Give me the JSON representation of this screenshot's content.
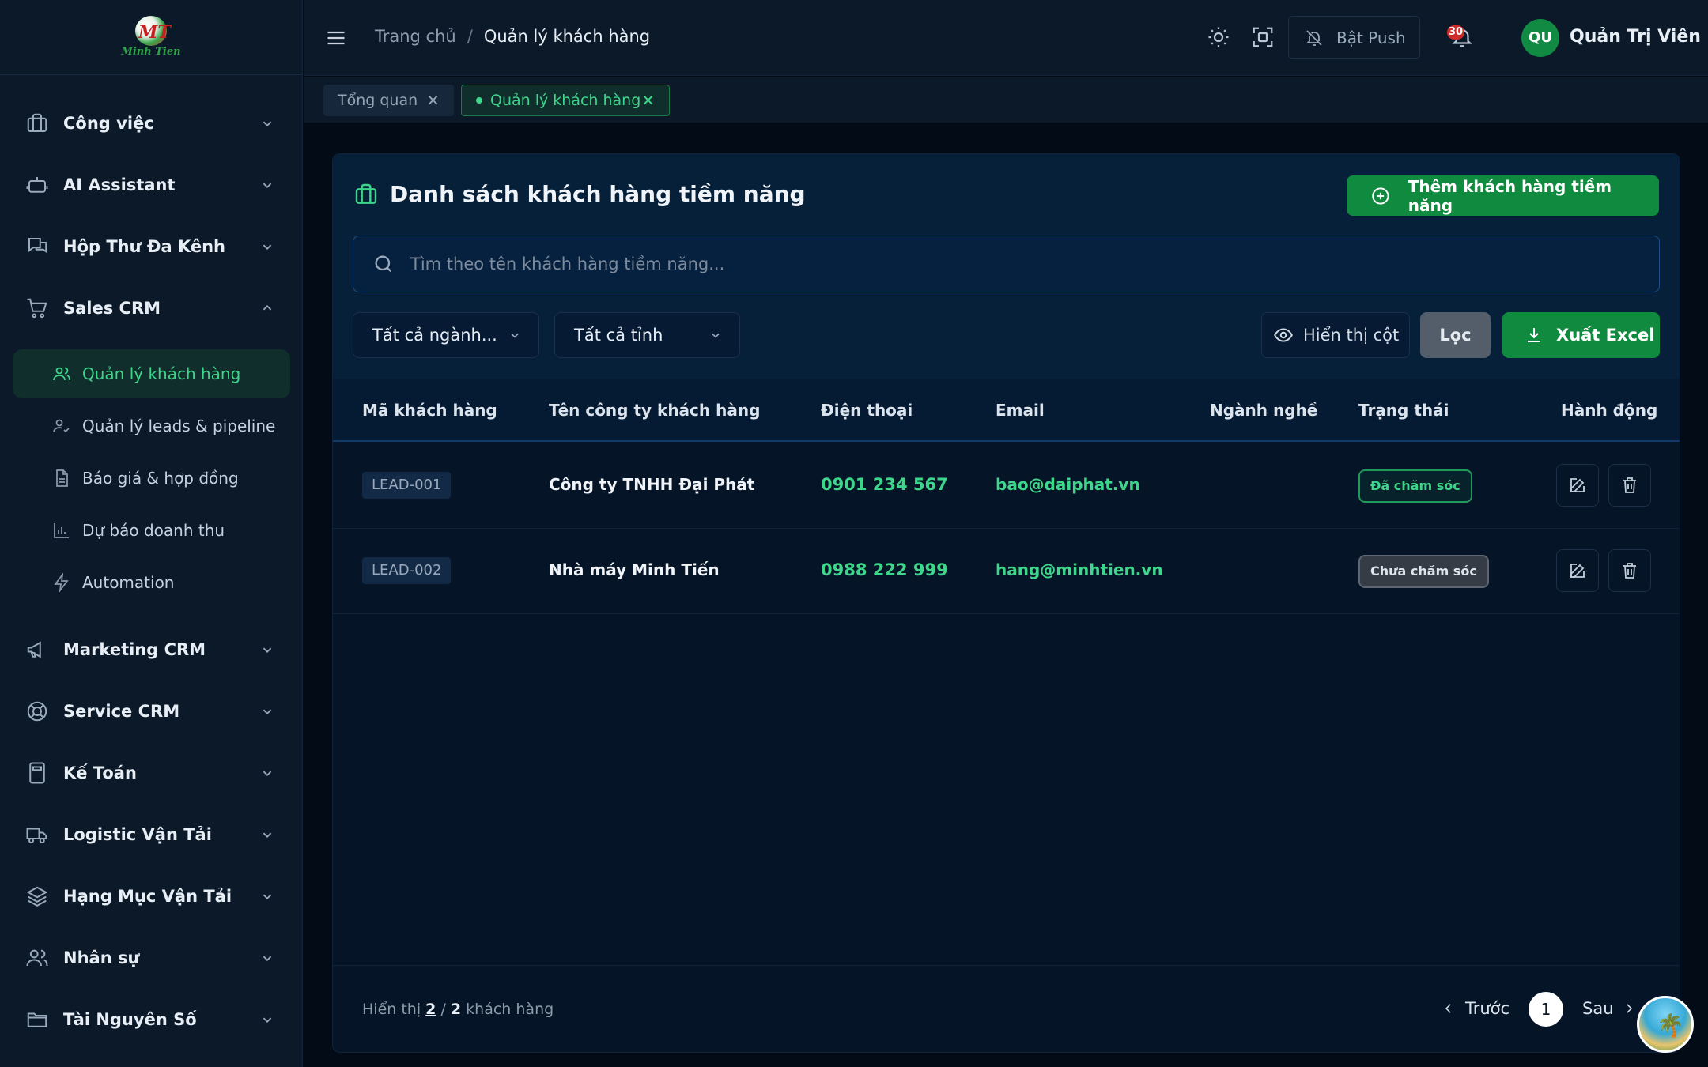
{
  "brand": {
    "logo_text": "MT",
    "logo_name": "Minh Tien"
  },
  "sidebar": {
    "groups": [
      {
        "label": "Công việc",
        "icon": "briefcase-icon"
      },
      {
        "label": "AI Assistant",
        "icon": "robot-icon"
      },
      {
        "label": "Hộp Thư Đa Kênh",
        "icon": "chat-icon"
      },
      {
        "label": "Sales CRM",
        "icon": "cart-icon"
      },
      {
        "label": "Marketing CRM",
        "icon": "megaphone-icon"
      },
      {
        "label": "Service CRM",
        "icon": "lifebuoy-icon"
      },
      {
        "label": "Kế Toán",
        "icon": "calculator-icon"
      },
      {
        "label": "Logistic Vận Tải",
        "icon": "truck-icon"
      },
      {
        "label": "Hạng Mục Vận Tải",
        "icon": "layers-icon"
      },
      {
        "label": "Nhân sự",
        "icon": "users-icon"
      },
      {
        "label": "Tài Nguyên Số",
        "icon": "folder-icon"
      }
    ],
    "sales_items": [
      {
        "label": "Quản lý khách hàng",
        "active": true
      },
      {
        "label": "Quản lý leads & pipeline"
      },
      {
        "label": "Báo giá & hợp đồng"
      },
      {
        "label": "Dự báo doanh thu"
      },
      {
        "label": "Automation"
      }
    ]
  },
  "header": {
    "breadcrumb_home": "Trang chủ",
    "breadcrumb_sep": "/",
    "breadcrumb_current": "Quản lý khách hàng",
    "push_label": "Bật Push",
    "notification_count": "30",
    "avatar_initials": "QU",
    "user_name": "Quản Trị Viên"
  },
  "tabs": [
    {
      "label": "Tổng quan",
      "active": false
    },
    {
      "label": "Quản lý khách hàng",
      "active": true
    }
  ],
  "card": {
    "title": "Danh sách khách hàng tiềm năng",
    "add_button": "Thêm khách hàng tiềm năng",
    "search_placeholder": "Tìm theo tên khách hàng tiềm năng...",
    "filter_industry": "Tất cả ngành...",
    "filter_province": "Tất cả tỉnh",
    "columns_button": "Hiển thị cột",
    "filter_button": "Lọc",
    "export_button": "Xuất Excel"
  },
  "table": {
    "headers": [
      "Mã khách hàng",
      "Tên công ty khách hàng",
      "Điện thoại",
      "Email",
      "Ngành nghề",
      "Trạng thái",
      "Hành động"
    ],
    "rows": [
      {
        "code": "LEAD-001",
        "company": "Công ty TNHH Đại Phát",
        "phone": "0901 234 567",
        "email": "bao@daiphat.vn",
        "industry": "",
        "status": "Đã chăm sóc"
      },
      {
        "code": "LEAD-002",
        "company": "Nhà máy Minh Tiến",
        "phone": "0988 222 999",
        "email": "hang@minhtien.vn",
        "industry": "",
        "status": "Chưa chăm sóc"
      }
    ]
  },
  "footer": {
    "showing_prefix": "Hiển thị",
    "showing_count": "2",
    "showing_sep": "/",
    "showing_total": "2",
    "showing_suffix": "khách hàng",
    "prev_label": "Trước",
    "current_page": "1",
    "next_label": "Sau"
  },
  "colors": {
    "accent": "#3ed68a",
    "primary_button": "#0f8a3f",
    "background": "#020b16",
    "sidebar": "#0b1929"
  }
}
